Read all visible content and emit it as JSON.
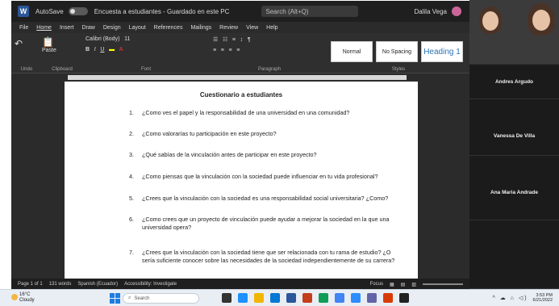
{
  "titlebar": {
    "autosave_label": "AutoSave",
    "doc_name": "Encuesta a estudiantes - Guardado en este PC",
    "search_placeholder": "Search (Alt+Q)",
    "user_name": "Dalila Vega"
  },
  "menu": [
    "File",
    "Home",
    "Insert",
    "Draw",
    "Design",
    "Layout",
    "References",
    "Mailings",
    "Review",
    "View",
    "Help"
  ],
  "ribbon": {
    "font_name": "Calibri (Body)",
    "font_size": "11",
    "groups": [
      "Undo",
      "Clipboard",
      "Font",
      "Paragraph",
      "Styles"
    ],
    "paste_label": "Paste",
    "styles": [
      "Normal",
      "No Spacing",
      "Heading 1"
    ]
  },
  "document": {
    "title": "Cuestionario a estudiantes",
    "questions": [
      {
        "num": "1.",
        "text": "¿Como ves el papel y la responsabilidad de una universidad en una comunidad?"
      },
      {
        "num": "2.",
        "text": "¿Como valorarías tu participación en este proyecto?"
      },
      {
        "num": "3.",
        "text": "¿Qué sabías de la vinculación antes de participar en este proyecto?"
      },
      {
        "num": "4.",
        "text": "¿Como piensas que la vinculación con la sociedad puede influenciar en tu vida profesional?"
      },
      {
        "num": "5.",
        "text": "¿Crees que la vinculación con la sociedad es una responsabilidad social universitaria? ¿Como?"
      },
      {
        "num": "6.",
        "text": "¿Como crees que un proyecto de vinculación puede ayudar a mejorar la sociedad en la que una universidad opera?"
      },
      {
        "num": "7.",
        "text": "¿Crees que la vinculación con la sociedad tiene que ser relacionada con tu rama de estudio? ¿O sería suficiente conocer sobre las necesidades de la sociedad independientemente de su carrera?"
      }
    ]
  },
  "statusbar": {
    "page": "Page 1 of 1",
    "words": "131 words",
    "language": "Spanish (Ecuador)",
    "accessibility": "Accessibility: Investigate",
    "focus": "Focus"
  },
  "participants": [
    {
      "name": "Andres Argudo"
    },
    {
      "name": "Vanessa De Villa"
    },
    {
      "name": "Ana Maria Andrade"
    }
  ],
  "taskbar": {
    "weather_temp": "16°C",
    "weather_desc": "Cloudy",
    "search_label": "Search",
    "time": "3:53 PM",
    "date": "6/21/2022"
  }
}
